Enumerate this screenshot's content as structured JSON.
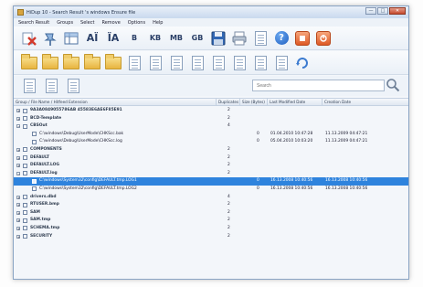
{
  "window": {
    "title": "HiDup 10 - Search Result 's windows Ensure file",
    "min_label": "—",
    "max_label": "□",
    "close_label": "✕"
  },
  "menu": [
    "Search Result",
    "Groups",
    "Select",
    "Remove",
    "Options",
    "Help"
  ],
  "toolbar": {
    "size_labels": [
      "AÏ",
      "ÏA",
      "B",
      "KB",
      "MB",
      "GB"
    ]
  },
  "search": {
    "placeholder": "Search"
  },
  "grid": {
    "columns": [
      "Group / File Name / Hitfeed Extension",
      "Duplicates",
      "Size (Bytes)",
      "Last Modified Date",
      "Creation Date"
    ],
    "rows": [
      {
        "type": "group",
        "name": "9A3A0849055786AB 45583E6AE6F85E91",
        "duplicates": "2"
      },
      {
        "type": "group",
        "name": "BCD-Template",
        "duplicates": "2"
      },
      {
        "type": "group",
        "name": "CBSOut",
        "duplicates": "4",
        "expanded": true
      },
      {
        "type": "file",
        "name": "C:\\windows\\Debug\\UserMode\\CHKScc.bak",
        "size": "0",
        "modified": "01.04.2010 10:47:28",
        "created": "11.13.2009 04:47:21"
      },
      {
        "type": "file",
        "name": "C:\\windows\\Debug\\UserMode\\CHKScc.log",
        "size": "0",
        "modified": "05.04.2010 10:03:20",
        "created": "11.13.2009 04:47:21"
      },
      {
        "type": "group",
        "name": "COMPONENTS",
        "duplicates": "2"
      },
      {
        "type": "group",
        "name": "DEFAULT",
        "duplicates": "2"
      },
      {
        "type": "group",
        "name": "DEFAULT.LOG",
        "duplicates": "2"
      },
      {
        "type": "group",
        "name": "DEFAULT.log",
        "duplicates": "2",
        "expanded": true
      },
      {
        "type": "file",
        "name": "C:\\windows\\System32\\config\\DEFAULT.tmp.LOG1",
        "size": "0",
        "modified": "16.13.2008 10:40:56",
        "created": "16.13.2008 10:40:56",
        "selected": true
      },
      {
        "type": "file",
        "name": "C:\\windows\\System32\\config\\DEFAULT.tmp.LOG2",
        "size": "0",
        "modified": "16.13.2008 10:40:56",
        "created": "16.13.2008 10:40:56"
      },
      {
        "type": "group",
        "name": "drivers.dbd",
        "duplicates": "4"
      },
      {
        "type": "group",
        "name": "RTUSER.bmp",
        "duplicates": "2"
      },
      {
        "type": "group",
        "name": "SAM",
        "duplicates": "2"
      },
      {
        "type": "group",
        "name": "SAM.tmp",
        "duplicates": "2"
      },
      {
        "type": "group",
        "name": "SCHEMA.tmp",
        "duplicates": "2"
      },
      {
        "type": "group",
        "name": "SECURITY",
        "duplicates": "2"
      }
    ]
  },
  "colors": {
    "selection": "#2e83dd",
    "title_gradient_top": "#e9f0f9",
    "accent_orange": "#de5a26"
  }
}
